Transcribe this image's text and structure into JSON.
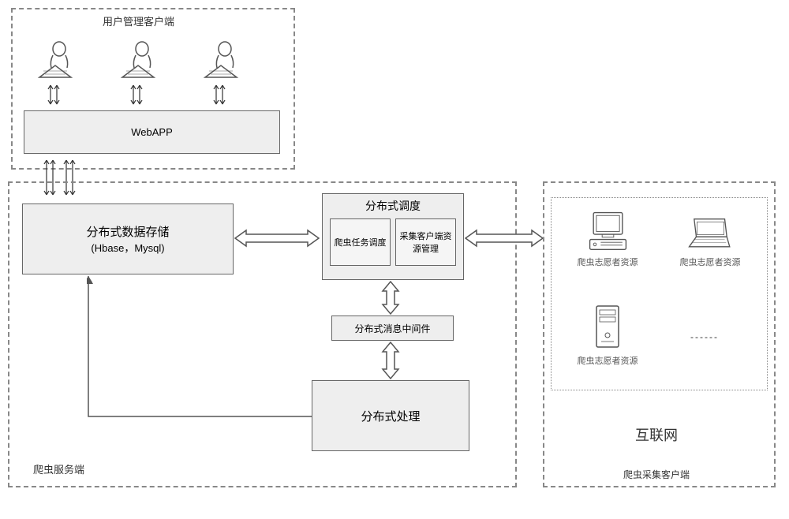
{
  "diagram": {
    "client_section": {
      "title": "用户管理客户端",
      "webapp": "WebAPP"
    },
    "server_section": {
      "title": "爬虫服务端",
      "storage": {
        "title": "分布式数据存储",
        "subtitle": "(Hbase，Mysql)"
      },
      "scheduling": {
        "title": "分布式调度",
        "task_scheduler": "爬虫任务调度",
        "resource_manager": "采集客户端资源管理"
      },
      "middleware": "分布式消息中间件",
      "processing": "分布式处理"
    },
    "collector_section": {
      "title": "爬虫采集客户端",
      "resource1": "爬虫志愿者资源",
      "resource2": "爬虫志愿者资源",
      "resource3": "爬虫志愿者资源",
      "internet": "互联网"
    }
  }
}
